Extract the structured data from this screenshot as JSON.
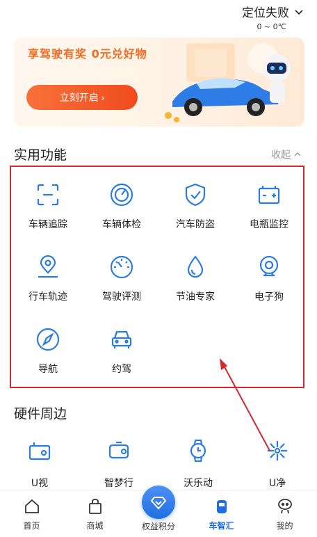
{
  "header": {
    "location_label": "定位失败",
    "temperature": "0 ~ 0℃"
  },
  "banner": {
    "title": "享驾驶有奖  0元兑好物",
    "button_label": "立刻开启 ›"
  },
  "practical": {
    "title": "实用功能",
    "collapse_label": "收起",
    "items": [
      {
        "label": "车辆追踪",
        "icon": "track-icon"
      },
      {
        "label": "车辆体检",
        "icon": "gauge-icon"
      },
      {
        "label": "汽车防盗",
        "icon": "shield-icon"
      },
      {
        "label": "电瓶监控",
        "icon": "battery-icon"
      },
      {
        "label": "行车轨迹",
        "icon": "location-pin-icon"
      },
      {
        "label": "驾驶评测",
        "icon": "speedometer-icon"
      },
      {
        "label": "节油专家",
        "icon": "drop-icon"
      },
      {
        "label": "电子狗",
        "icon": "camera-icon"
      },
      {
        "label": "导航",
        "icon": "compass-icon"
      },
      {
        "label": "约驾",
        "icon": "car-icon"
      }
    ]
  },
  "hardware": {
    "title": "硬件周边",
    "items": [
      {
        "label": "U视",
        "icon": "dashcam-icon"
      },
      {
        "label": "智梦行",
        "icon": "device-icon"
      },
      {
        "label": "沃乐动",
        "icon": "watch-icon"
      },
      {
        "label": "U净",
        "icon": "purifier-icon"
      }
    ]
  },
  "tabbar": {
    "items": [
      {
        "label": "首页",
        "icon": "home-icon"
      },
      {
        "label": "商城",
        "icon": "bag-icon"
      },
      {
        "label": "权益积分",
        "icon": "diamond-icon"
      },
      {
        "label": "车智汇",
        "icon": "car-device-icon"
      },
      {
        "label": "我的",
        "icon": "profile-icon"
      }
    ],
    "active_index": 3
  },
  "colors": {
    "accent_blue": "#1f6fe0",
    "icon_blue": "#2a7be4",
    "banner_orange": "#f26b21",
    "annotation_red": "#d8262e"
  }
}
